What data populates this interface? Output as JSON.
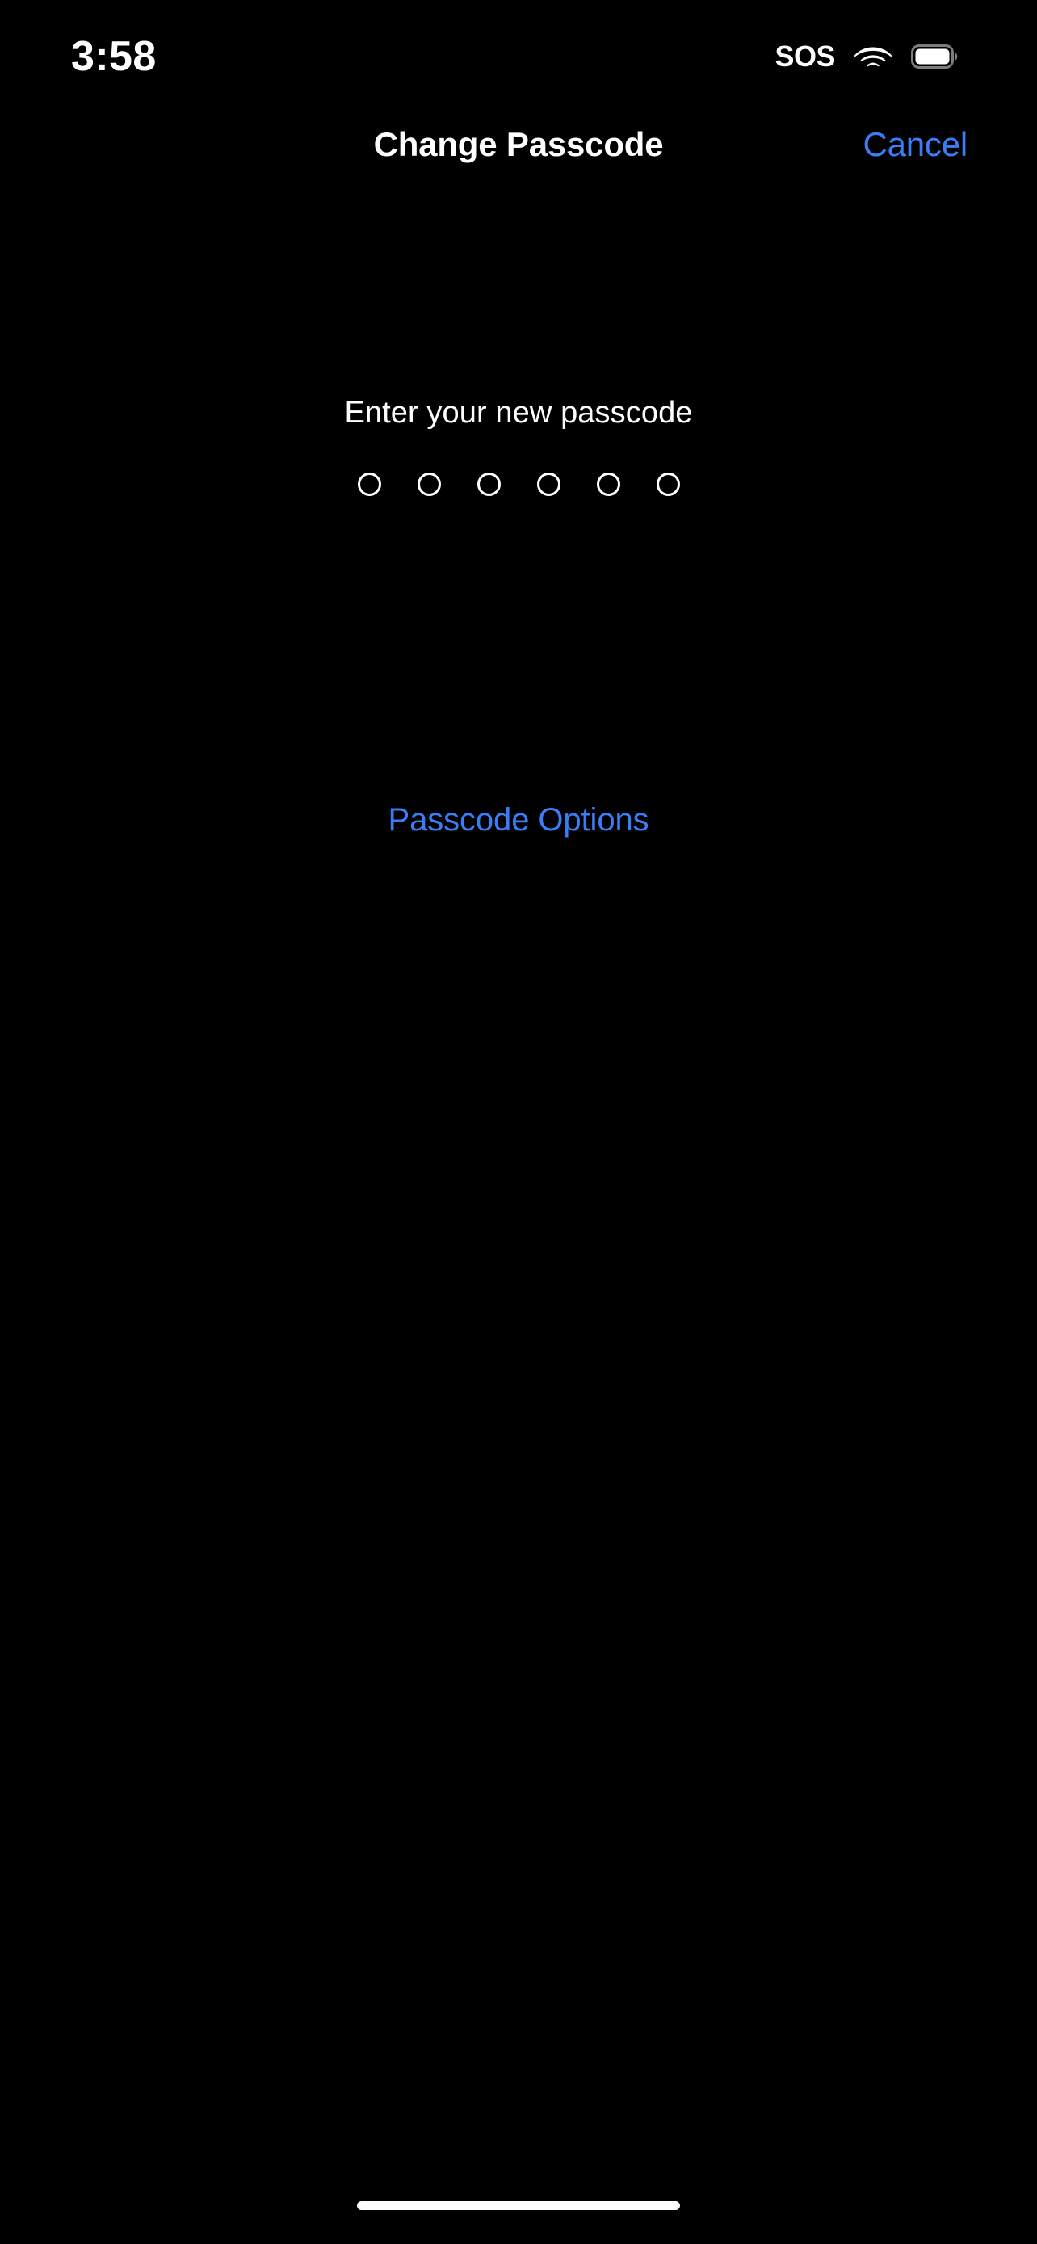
{
  "status_bar": {
    "time": "3:58",
    "sos_label": "SOS",
    "wifi_icon": "wifi-icon",
    "battery_icon": "battery-icon",
    "battery_level_percent": 95
  },
  "nav_bar": {
    "title": "Change Passcode",
    "cancel_label": "Cancel"
  },
  "passcode": {
    "prompt": "Enter your new passcode",
    "length": 6,
    "entered_count": 0,
    "dots": [
      {
        "filled": false
      },
      {
        "filled": false
      },
      {
        "filled": false
      },
      {
        "filled": false
      },
      {
        "filled": false
      },
      {
        "filled": false
      }
    ]
  },
  "options": {
    "passcode_options_label": "Passcode Options"
  },
  "colors": {
    "background": "#000000",
    "primary_text": "#ffffff",
    "accent_blue": "#3B7DF5",
    "dot_outline": "#ffffff",
    "home_indicator": "#ffffff"
  }
}
